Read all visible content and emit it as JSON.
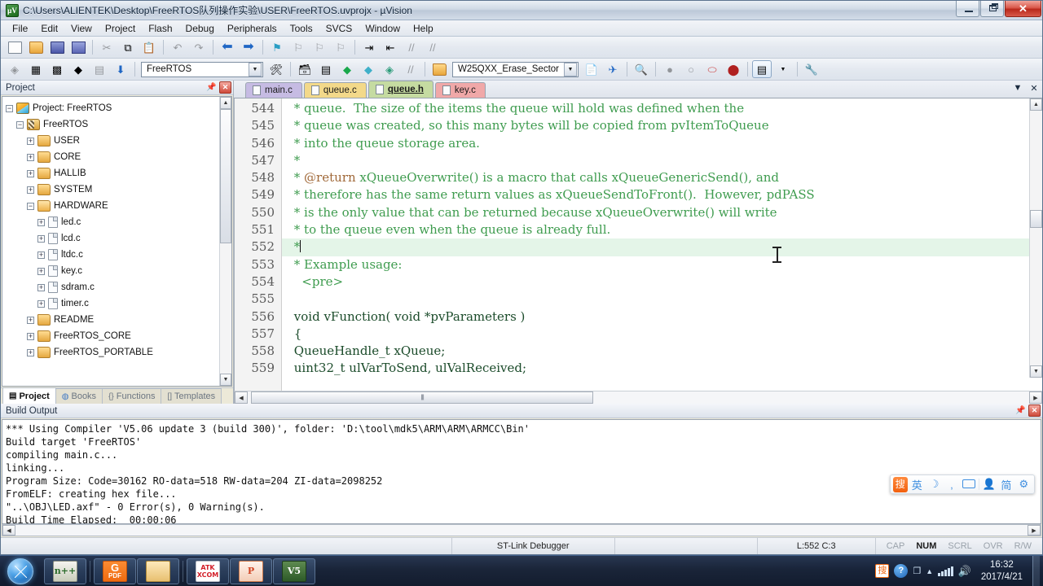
{
  "window": {
    "title": "C:\\Users\\ALIENTEK\\Desktop\\FreeRTOS队列操作实验\\USER\\FreeRTOS.uvprojx - µVision",
    "app_icon": "uvision-icon",
    "minimize": "—",
    "restore": "❐",
    "close": "✕"
  },
  "menu": [
    "File",
    "Edit",
    "View",
    "Project",
    "Flash",
    "Debug",
    "Peripherals",
    "Tools",
    "SVCS",
    "Window",
    "Help"
  ],
  "toolbar": {
    "target_value": "FreeRTOS",
    "function_value": "W25QXX_Erase_Sector",
    "items_row1": [
      "new-file",
      "open-file",
      "save",
      "save-all",
      "cut",
      "copy",
      "paste",
      "undo",
      "redo",
      "navigate-back",
      "navigate-forward",
      "bookmark-toggle",
      "bookmark-prev",
      "bookmark-next",
      "bookmark-clear",
      "indent",
      "outdent",
      "comment",
      "uncomment"
    ],
    "items_row2": [
      "build-file",
      "build-target",
      "rebuild-all",
      "batch-build",
      "stop-build",
      "download",
      "target-options",
      "manage-project",
      "debug-start",
      "config-wizard",
      "project-window"
    ]
  },
  "project_panel": {
    "title": "Project",
    "pin_icon": "pin-icon",
    "close_icon": "close-icon",
    "tree": [
      {
        "label": "Project: FreeRTOS",
        "indent": 0,
        "expander": "−",
        "icon": "project-icon"
      },
      {
        "label": "FreeRTOS",
        "indent": 1,
        "expander": "−",
        "icon": "target-icon"
      },
      {
        "label": "USER",
        "indent": 2,
        "expander": "+",
        "icon": "folder-icon"
      },
      {
        "label": "CORE",
        "indent": 2,
        "expander": "+",
        "icon": "folder-icon"
      },
      {
        "label": "HALLIB",
        "indent": 2,
        "expander": "+",
        "icon": "folder-icon"
      },
      {
        "label": "SYSTEM",
        "indent": 2,
        "expander": "+",
        "icon": "folder-icon"
      },
      {
        "label": "HARDWARE",
        "indent": 2,
        "expander": "−",
        "icon": "folder-open-icon"
      },
      {
        "label": "led.c",
        "indent": 3,
        "expander": "+",
        "icon": "file-icon"
      },
      {
        "label": "lcd.c",
        "indent": 3,
        "expander": "+",
        "icon": "file-icon"
      },
      {
        "label": "ltdc.c",
        "indent": 3,
        "expander": "+",
        "icon": "file-icon"
      },
      {
        "label": "key.c",
        "indent": 3,
        "expander": "+",
        "icon": "file-icon"
      },
      {
        "label": "sdram.c",
        "indent": 3,
        "expander": "+",
        "icon": "file-icon"
      },
      {
        "label": "timer.c",
        "indent": 3,
        "expander": "+",
        "icon": "file-icon"
      },
      {
        "label": "README",
        "indent": 2,
        "expander": "+",
        "icon": "folder-icon"
      },
      {
        "label": "FreeRTOS_CORE",
        "indent": 2,
        "expander": "+",
        "icon": "folder-icon"
      },
      {
        "label": "FreeRTOS_PORTABLE",
        "indent": 2,
        "expander": "+",
        "icon": "folder-icon"
      }
    ],
    "tabs": [
      {
        "label": "Project",
        "icon": "project-tab-icon",
        "active": true
      },
      {
        "label": "Books",
        "icon": "books-icon",
        "active": false
      },
      {
        "label": "Functions",
        "icon": "braces-icon",
        "active": false
      },
      {
        "label": "Templates",
        "icon": "templates-icon",
        "active": false
      }
    ]
  },
  "editor": {
    "tabs": [
      {
        "label": "main.c",
        "color": "#c6bbe3",
        "active": false
      },
      {
        "label": "queue.c",
        "color": "#f3d98a",
        "active": false
      },
      {
        "label": "queue.h",
        "color": "#c5dba1",
        "active": true
      },
      {
        "label": "key.c",
        "color": "#f0a8a8",
        "active": false
      }
    ],
    "tab_menu_icon": "chevron-down-icon",
    "tab_close_icon": "close-icon",
    "cursor_line": 552,
    "lines": [
      {
        "num": 544,
        "text": " * queue.  The size of the items the queue will hold was defined when the",
        "style": "comment"
      },
      {
        "num": 545,
        "text": " * queue was created, so this many bytes will be copied from pvItemToQueue",
        "style": "comment"
      },
      {
        "num": 546,
        "text": " * into the queue storage area.",
        "style": "comment"
      },
      {
        "num": 547,
        "text": " *",
        "style": "comment"
      },
      {
        "num": 548,
        "text": " * @return xQueueOverwrite() is a macro that calls xQueueGenericSend(), and",
        "style": "comment-tag"
      },
      {
        "num": 549,
        "text": " * therefore has the same return values as xQueueSendToFront().  However, pdPASS",
        "style": "comment"
      },
      {
        "num": 550,
        "text": " * is the only value that can be returned because xQueueOverwrite() will write",
        "style": "comment"
      },
      {
        "num": 551,
        "text": " * to the queue even when the queue is already full.",
        "style": "comment"
      },
      {
        "num": 552,
        "text": " *",
        "style": "comment-current"
      },
      {
        "num": 553,
        "text": " * Example usage:",
        "style": "comment"
      },
      {
        "num": 554,
        "text": "   <pre>",
        "style": "comment"
      },
      {
        "num": 555,
        "text": "",
        "style": "comment"
      },
      {
        "num": 556,
        "text": " void vFunction( void *pvParameters )",
        "style": "code"
      },
      {
        "num": 557,
        "text": " {",
        "style": "code"
      },
      {
        "num": 558,
        "text": " QueueHandle_t xQueue;",
        "style": "code"
      },
      {
        "num": 559,
        "text": " uint32_t ulVarToSend, ulValReceived;",
        "style": "code"
      }
    ]
  },
  "build_output": {
    "title": "Build Output",
    "lines": [
      "*** Using Compiler 'V5.06 update 3 (build 300)', folder: 'D:\\tool\\mdk5\\ARM\\ARM\\ARMCC\\Bin'",
      "Build target 'FreeRTOS'",
      "compiling main.c...",
      "linking...",
      "Program Size: Code=30162 RO-data=518 RW-data=204 ZI-data=2098252",
      "FromELF: creating hex file...",
      "\"..\\OBJ\\LED.axf\" - 0 Error(s), 0 Warning(s).",
      "Build Time Elapsed:  00:00:06"
    ],
    "pin_icon": "pin-icon",
    "close_icon": "close-icon"
  },
  "statusbar": {
    "debugger": "ST-Link Debugger",
    "position": "L:552 C:3",
    "indicators": [
      {
        "label": "CAP",
        "on": false
      },
      {
        "label": "NUM",
        "on": true
      },
      {
        "label": "SCRL",
        "on": false
      },
      {
        "label": "OVR",
        "on": false
      },
      {
        "label": "R/W",
        "on": false
      }
    ]
  },
  "ime_bar": {
    "logo": "sogou-logo-icon",
    "mode": "英",
    "items": [
      "moon-icon",
      "comma-icon",
      "keyboard-icon",
      "user-icon"
    ],
    "script": "简",
    "settings": "gear-icon"
  },
  "taskbar": {
    "start": "start-orb-icon",
    "items": [
      {
        "name": "notepadpp",
        "label": "N++"
      },
      {
        "name": "foxit-pdf",
        "label": "PDF"
      },
      {
        "name": "file-explorer",
        "label": ""
      },
      {
        "name": "atk-xcom",
        "label_top": "ATK",
        "label_bottom": "XCOM"
      },
      {
        "name": "powerpoint",
        "label": "P"
      },
      {
        "name": "uvision",
        "label": "V5"
      }
    ],
    "tray": {
      "sogou": "搜",
      "help": "?",
      "time": "16:32",
      "date": "2017/4/21"
    }
  }
}
